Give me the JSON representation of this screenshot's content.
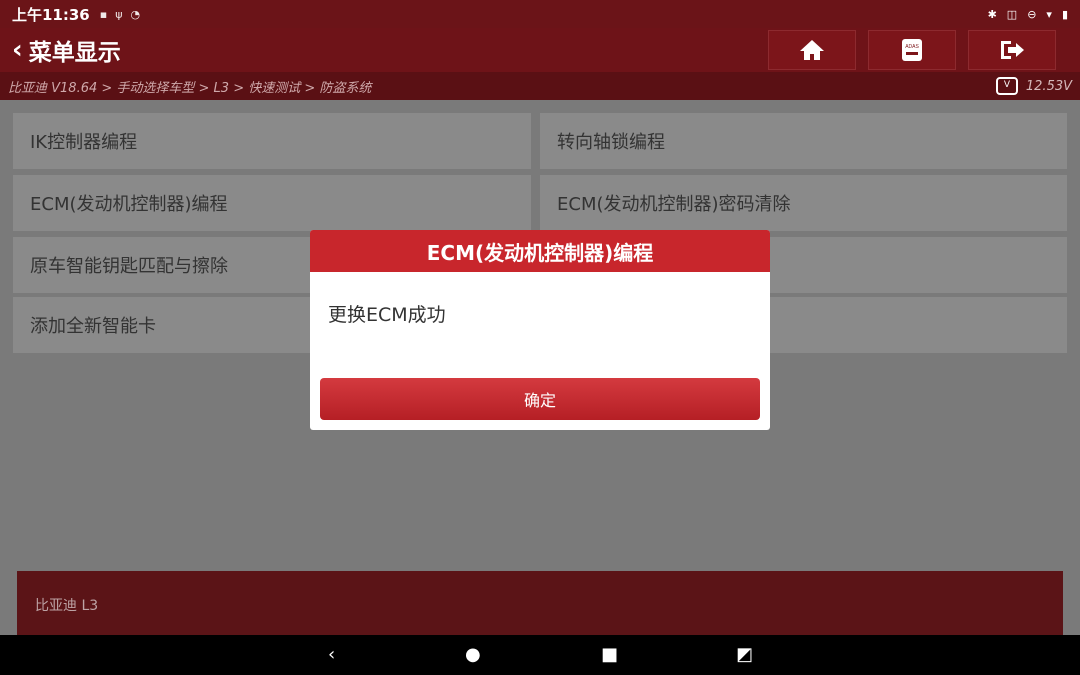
{
  "status": {
    "time": "上午11:36"
  },
  "header": {
    "back_icon": "chevron-left-icon",
    "title": "菜单显示",
    "buttons": [
      "home-icon",
      "adas-icon",
      "exit-icon"
    ]
  },
  "breadcrumb": {
    "path": "比亚迪 V18.64 > 手动选择车型 > L3 > 快速测试 > 防盗系统",
    "voltage": "12.53V"
  },
  "menu": {
    "items": [
      "IK控制器编程",
      "转向轴锁编程",
      "ECM(发动机控制器)编程",
      "ECM(发动机控制器)密码清除",
      "原车智能钥匙匹配与擦除",
      "添加全新智能卡"
    ]
  },
  "bottom": {
    "label": "比亚迪 L3"
  },
  "dialog": {
    "title": "ECM(发动机控制器)编程",
    "message": "更换ECM成功",
    "confirm": "确定"
  },
  "colors": {
    "primary": "#c8262c",
    "header": "#6e1318",
    "tile_dim": "#8a8a8a"
  }
}
